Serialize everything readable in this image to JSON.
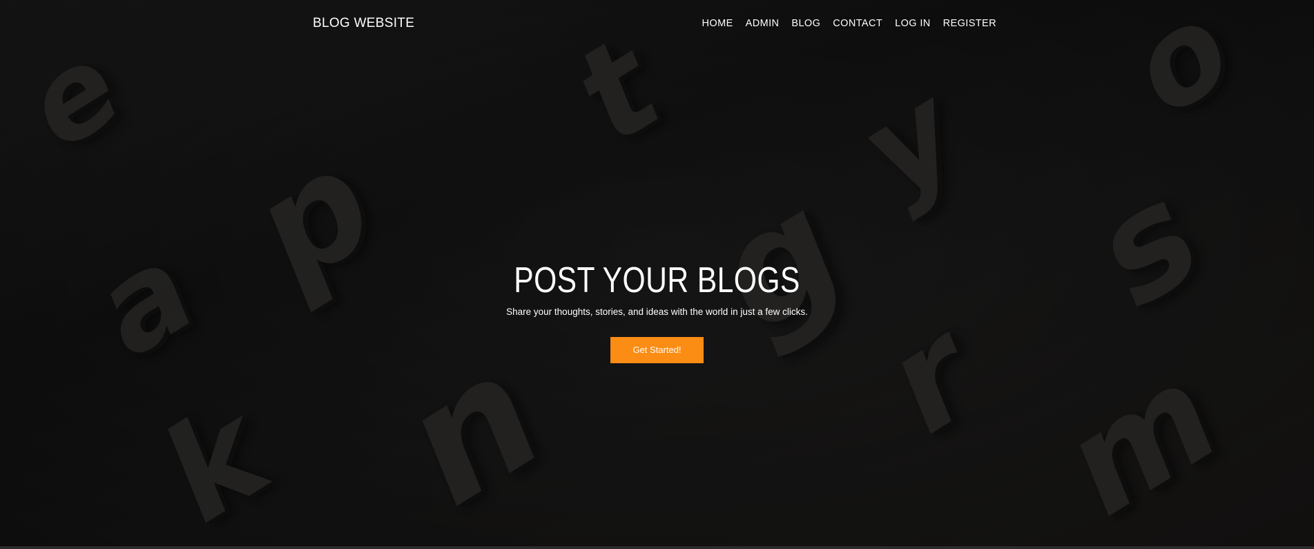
{
  "nav": {
    "brand": "BLOG WEBSITE",
    "links": [
      {
        "label": "HOME"
      },
      {
        "label": "ADMIN"
      },
      {
        "label": "BLOG"
      },
      {
        "label": "CONTACT"
      },
      {
        "label": "LOG IN"
      },
      {
        "label": "REGISTER"
      }
    ]
  },
  "hero": {
    "title": "POST YOUR BLOGS",
    "subtitle": "Share your thoughts, stories, and ideas with the world in just a few clicks.",
    "cta_label": "Get Started!"
  },
  "colors": {
    "accent": "#fb8c14",
    "text": "#ffffff",
    "background": "#1f1f1f"
  }
}
